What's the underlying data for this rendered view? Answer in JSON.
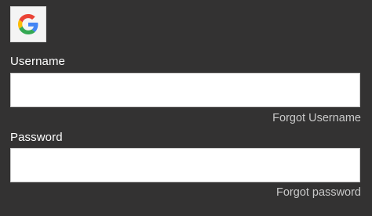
{
  "google_button": {
    "icon": "google-g-logo-icon",
    "colors": {
      "blue": "#4285F4",
      "red": "#EA4335",
      "yellow": "#FBBC05",
      "green": "#34A853"
    }
  },
  "username": {
    "label": "Username",
    "value": "",
    "placeholder": "",
    "forgot_link": "Forgot Username"
  },
  "password": {
    "label": "Password",
    "value": "",
    "placeholder": "",
    "forgot_link": "Forgot password"
  },
  "theme": {
    "background": "#333232",
    "label_color": "#ffffff",
    "link_color": "#c9c9c9"
  }
}
